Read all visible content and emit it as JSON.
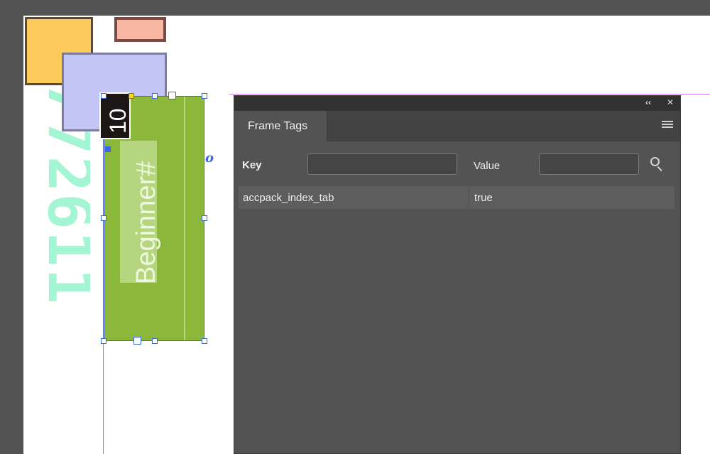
{
  "canvas": {
    "vertical_number": "3772611",
    "badge_number": "10",
    "tab_label": "Beginner#",
    "frame_marker": "o",
    "colors": {
      "pasteboard": "#535353",
      "page": "#ffffff",
      "yellow_shape": "#fccb5b",
      "salmon_shape": "#f8b7a3",
      "lavender_shape": "#c4c5f7",
      "tab_green": "#8bb83b",
      "vertical_number_mint": "#a3f5d3",
      "selection_blue": "#3b68e0"
    }
  },
  "panel": {
    "collapse_icon": "double-chevron-left-icon",
    "close_icon": "close-icon",
    "collapse_glyph": "‹‹",
    "close_glyph": "✕",
    "tab_title": "Frame Tags",
    "menu_icon": "hamburger-menu-icon",
    "key_label": "Key",
    "value_label": "Value",
    "key_input_value": "",
    "value_input_value": "",
    "search_icon": "search-icon",
    "rows": [
      {
        "key": "accpack_index_tab",
        "value": "true"
      }
    ]
  }
}
